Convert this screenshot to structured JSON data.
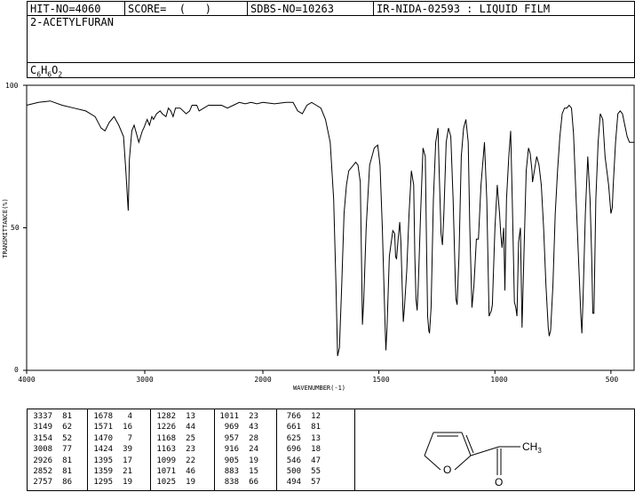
{
  "header": {
    "hit_no": "HIT-NO=4060",
    "score": "SCORE=  (   )",
    "sdbs_no": "SDBS-NO=10263",
    "ir_id": "IR-NIDA-02593 : LIQUID FILM"
  },
  "compound": {
    "name": "2-ACETYLFURAN",
    "formula_parts": [
      "C",
      "6",
      "H",
      "6",
      "O",
      "2"
    ]
  },
  "chart_data": {
    "type": "line",
    "title": "",
    "xlabel": "WAVENUMBER(-1)",
    "ylabel": "TRANSMITTANCE(%)",
    "xlim": [
      4000,
      400
    ],
    "ylim": [
      0,
      100
    ],
    "xticks": [
      "4000",
      "3000",
      "2000",
      "1500",
      "1000",
      "500"
    ],
    "yticks": [
      "100",
      "50",
      "0"
    ],
    "grid": false,
    "series": [
      {
        "values_description": "transmittance spectrum",
        "points": [
          [
            4000,
            93
          ],
          [
            3900,
            94
          ],
          [
            3800,
            94.5
          ],
          [
            3700,
            93
          ],
          [
            3600,
            92
          ],
          [
            3500,
            91
          ],
          [
            3420,
            89
          ],
          [
            3370,
            85
          ],
          [
            3337,
            84
          ],
          [
            3300,
            87
          ],
          [
            3260,
            89
          ],
          [
            3220,
            86
          ],
          [
            3180,
            82
          ],
          [
            3160,
            70
          ],
          [
            3149,
            62
          ],
          [
            3140,
            56
          ],
          [
            3130,
            74
          ],
          [
            3110,
            84
          ],
          [
            3090,
            86
          ],
          [
            3070,
            83
          ],
          [
            3050,
            80
          ],
          [
            3020,
            84
          ],
          [
            3008,
            85
          ],
          [
            2980,
            88
          ],
          [
            2960,
            86
          ],
          [
            2940,
            89
          ],
          [
            2926,
            88
          ],
          [
            2900,
            90
          ],
          [
            2870,
            91
          ],
          [
            2852,
            90
          ],
          [
            2820,
            89
          ],
          [
            2800,
            92
          ],
          [
            2780,
            91
          ],
          [
            2760,
            89
          ],
          [
            2740,
            92
          ],
          [
            2700,
            92
          ],
          [
            2650,
            90
          ],
          [
            2620,
            91
          ],
          [
            2600,
            93
          ],
          [
            2560,
            93
          ],
          [
            2540,
            91
          ],
          [
            2500,
            92
          ],
          [
            2460,
            93
          ],
          [
            2400,
            93
          ],
          [
            2350,
            93
          ],
          [
            2300,
            92
          ],
          [
            2250,
            93
          ],
          [
            2200,
            94
          ],
          [
            2150,
            93.5
          ],
          [
            2100,
            94
          ],
          [
            2050,
            93.5
          ],
          [
            2000,
            94
          ],
          [
            1950,
            93.5
          ],
          [
            1900,
            94
          ],
          [
            1870,
            94
          ],
          [
            1850,
            91
          ],
          [
            1830,
            90
          ],
          [
            1810,
            93
          ],
          [
            1790,
            94
          ],
          [
            1770,
            93
          ],
          [
            1750,
            92
          ],
          [
            1730,
            88
          ],
          [
            1710,
            80
          ],
          [
            1695,
            60
          ],
          [
            1685,
            30
          ],
          [
            1678,
            5
          ],
          [
            1670,
            8
          ],
          [
            1660,
            30
          ],
          [
            1650,
            55
          ],
          [
            1640,
            65
          ],
          [
            1630,
            70
          ],
          [
            1610,
            72
          ],
          [
            1600,
            73
          ],
          [
            1590,
            72
          ],
          [
            1580,
            66
          ],
          [
            1575,
            40
          ],
          [
            1571,
            16
          ],
          [
            1565,
            25
          ],
          [
            1555,
            50
          ],
          [
            1540,
            72
          ],
          [
            1520,
            78
          ],
          [
            1505,
            79
          ],
          [
            1495,
            72
          ],
          [
            1485,
            50
          ],
          [
            1475,
            20
          ],
          [
            1470,
            7
          ],
          [
            1465,
            15
          ],
          [
            1455,
            40
          ],
          [
            1440,
            49
          ],
          [
            1432,
            48
          ],
          [
            1428,
            40
          ],
          [
            1424,
            39
          ],
          [
            1418,
            45
          ],
          [
            1410,
            52
          ],
          [
            1405,
            45
          ],
          [
            1400,
            30
          ],
          [
            1395,
            17
          ],
          [
            1390,
            22
          ],
          [
            1380,
            35
          ],
          [
            1370,
            55
          ],
          [
            1360,
            70
          ],
          [
            1350,
            65
          ],
          [
            1345,
            40
          ],
          [
            1340,
            25
          ],
          [
            1335,
            21
          ],
          [
            1330,
            30
          ],
          [
            1320,
            55
          ],
          [
            1310,
            78
          ],
          [
            1300,
            75
          ],
          [
            1295,
            45
          ],
          [
            1290,
            19
          ],
          [
            1285,
            14
          ],
          [
            1282,
            13
          ],
          [
            1275,
            22
          ],
          [
            1265,
            60
          ],
          [
            1255,
            80
          ],
          [
            1245,
            85
          ],
          [
            1240,
            70
          ],
          [
            1232,
            48
          ],
          [
            1226,
            44
          ],
          [
            1220,
            55
          ],
          [
            1210,
            80
          ],
          [
            1200,
            85
          ],
          [
            1190,
            82
          ],
          [
            1180,
            60
          ],
          [
            1170,
            30
          ],
          [
            1168,
            25
          ],
          [
            1163,
            23
          ],
          [
            1155,
            40
          ],
          [
            1145,
            75
          ],
          [
            1135,
            85
          ],
          [
            1125,
            88
          ],
          [
            1115,
            80
          ],
          [
            1108,
            50
          ],
          [
            1099,
            22
          ],
          [
            1090,
            30
          ],
          [
            1080,
            46
          ],
          [
            1071,
            46
          ],
          [
            1060,
            65
          ],
          [
            1045,
            80
          ],
          [
            1035,
            60
          ],
          [
            1025,
            19
          ],
          [
            1015,
            21
          ],
          [
            1011,
            23
          ],
          [
            1000,
            50
          ],
          [
            990,
            65
          ],
          [
            980,
            55
          ],
          [
            975,
            48
          ],
          [
            969,
            43
          ],
          [
            962,
            50
          ],
          [
            957,
            28
          ],
          [
            950,
            60
          ],
          [
            940,
            75
          ],
          [
            932,
            84
          ],
          [
            925,
            60
          ],
          [
            916,
            24
          ],
          [
            910,
            22
          ],
          [
            905,
            19
          ],
          [
            898,
            45
          ],
          [
            890,
            50
          ],
          [
            883,
            15
          ],
          [
            875,
            40
          ],
          [
            865,
            70
          ],
          [
            855,
            78
          ],
          [
            848,
            76
          ],
          [
            840,
            70
          ],
          [
            838,
            66
          ],
          [
            830,
            70
          ],
          [
            820,
            75
          ],
          [
            810,
            72
          ],
          [
            800,
            65
          ],
          [
            790,
            50
          ],
          [
            780,
            30
          ],
          [
            770,
            15
          ],
          [
            766,
            12
          ],
          [
            760,
            14
          ],
          [
            750,
            30
          ],
          [
            740,
            55
          ],
          [
            730,
            70
          ],
          [
            720,
            82
          ],
          [
            710,
            90
          ],
          [
            700,
            92
          ],
          [
            696,
            92
          ],
          [
            690,
            92
          ],
          [
            680,
            93
          ],
          [
            670,
            92
          ],
          [
            661,
            83
          ],
          [
            650,
            60
          ],
          [
            640,
            40
          ],
          [
            630,
            20
          ],
          [
            625,
            13
          ],
          [
            620,
            25
          ],
          [
            610,
            55
          ],
          [
            600,
            75
          ],
          [
            590,
            60
          ],
          [
            583,
            40
          ],
          [
            578,
            20
          ],
          [
            573,
            20
          ],
          [
            565,
            60
          ],
          [
            555,
            80
          ],
          [
            546,
            90
          ],
          [
            535,
            88
          ],
          [
            525,
            75
          ],
          [
            510,
            65
          ],
          [
            500,
            55
          ],
          [
            494,
            57
          ],
          [
            490,
            65
          ],
          [
            480,
            80
          ],
          [
            470,
            90
          ],
          [
            460,
            91
          ],
          [
            450,
            90
          ],
          [
            440,
            86
          ],
          [
            430,
            82
          ],
          [
            420,
            80
          ],
          [
            410,
            80
          ],
          [
            400,
            80
          ]
        ]
      }
    ]
  },
  "peak_table": [
    [
      [
        "3337",
        "81"
      ],
      [
        "3149",
        "62"
      ],
      [
        "3154",
        "52"
      ],
      [
        "3008",
        "77"
      ],
      [
        "2926",
        "81"
      ],
      [
        "2852",
        "81"
      ],
      [
        "2757",
        "86"
      ]
    ],
    [
      [
        "1678",
        "4"
      ],
      [
        "1571",
        "16"
      ],
      [
        "1470",
        "7"
      ],
      [
        "1424",
        "39"
      ],
      [
        "1395",
        "17"
      ],
      [
        "1359",
        "21"
      ],
      [
        "1295",
        "19"
      ]
    ],
    [
      [
        "1282",
        "13"
      ],
      [
        "1226",
        "44"
      ],
      [
        "1168",
        "25"
      ],
      [
        "1163",
        "23"
      ],
      [
        "1099",
        "22"
      ],
      [
        "1071",
        "46"
      ],
      [
        "1025",
        "19"
      ]
    ],
    [
      [
        "1011",
        "23"
      ],
      [
        "969",
        "43"
      ],
      [
        "957",
        "28"
      ],
      [
        "916",
        "24"
      ],
      [
        "905",
        "19"
      ],
      [
        "883",
        "15"
      ],
      [
        "838",
        "66"
      ]
    ],
    [
      [
        "766",
        "12"
      ],
      [
        "661",
        "81"
      ],
      [
        "625",
        "13"
      ],
      [
        "696",
        "18"
      ],
      [
        "546",
        "47"
      ],
      [
        "500",
        "55"
      ],
      [
        "494",
        "57"
      ]
    ]
  ],
  "structure": {
    "substituent_label": "CH",
    "substituent_sub": "3",
    "ring_heteroatom": "O",
    "carbonyl_oxygen": "O"
  }
}
